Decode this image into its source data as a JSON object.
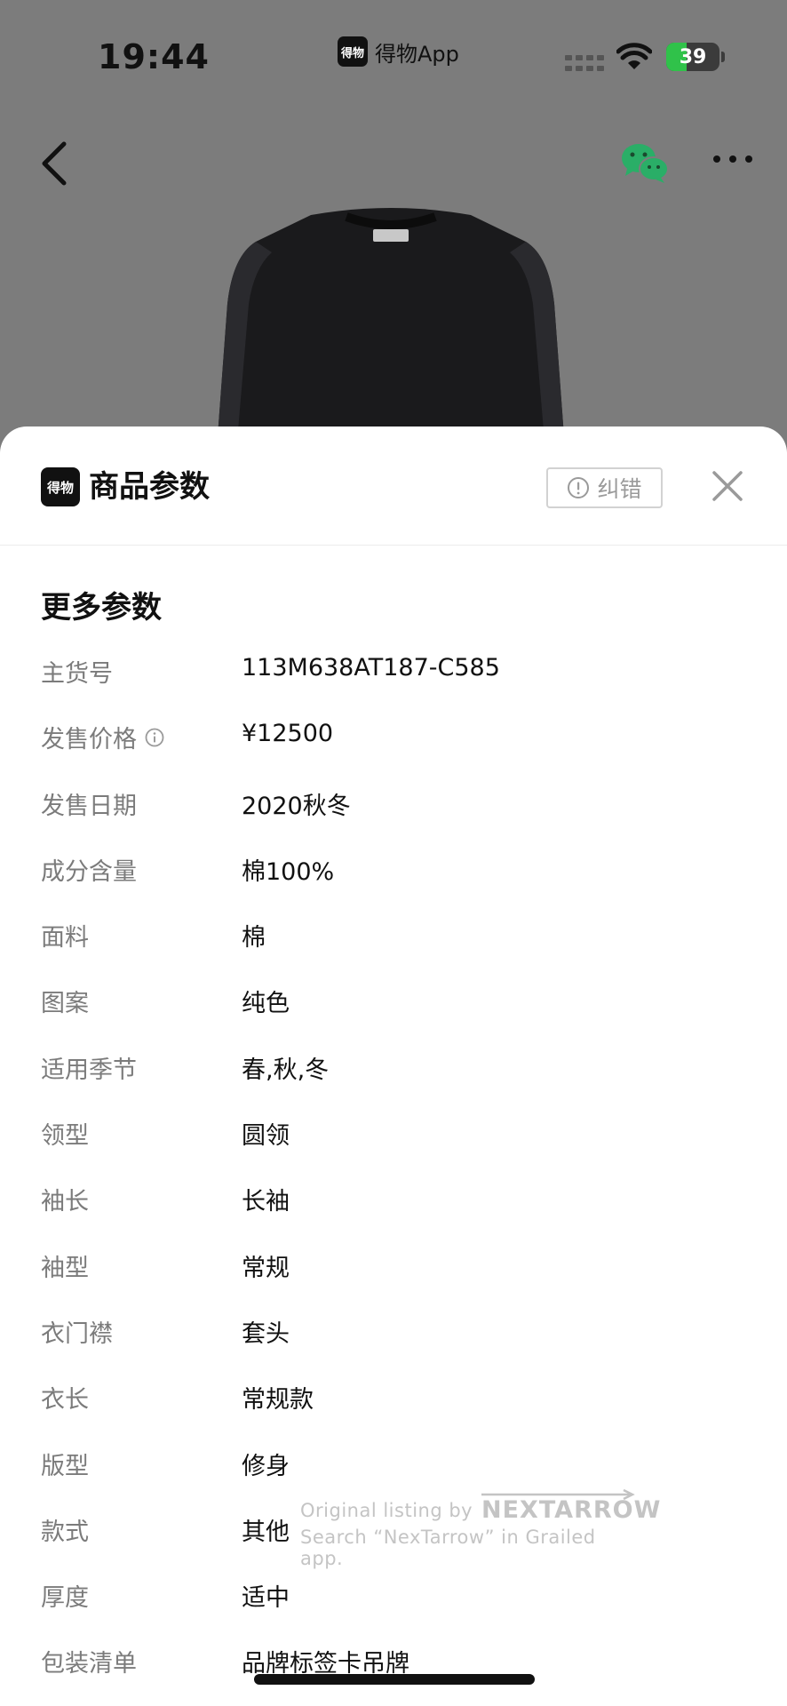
{
  "status_bar": {
    "time": "19:44",
    "app_name": "得物App",
    "app_logo_text": "得物",
    "battery_level": "39",
    "battery_fraction": 0.39
  },
  "nav": {
    "back_icon": "chevron-left-icon",
    "share_icon": "wechat-icon",
    "more_icon": "ellipsis-icon"
  },
  "sheet": {
    "logo_text": "得物",
    "title": "商品参数",
    "report_label": "纠错",
    "section_title": "更多参数",
    "params": [
      {
        "label": "主货号",
        "value": "113M638AT187-C585",
        "info": false
      },
      {
        "label": "发售价格",
        "value": "¥12500",
        "info": true
      },
      {
        "label": "发售日期",
        "value": "2020秋冬",
        "info": false
      },
      {
        "label": "成分含量",
        "value": "棉100%",
        "info": false
      },
      {
        "label": "面料",
        "value": "棉",
        "info": false
      },
      {
        "label": "图案",
        "value": "纯色",
        "info": false
      },
      {
        "label": "适用季节",
        "value": "春,秋,冬",
        "info": false
      },
      {
        "label": "领型",
        "value": "圆领",
        "info": false
      },
      {
        "label": "袖长",
        "value": "长袖",
        "info": false
      },
      {
        "label": "袖型",
        "value": "常规",
        "info": false
      },
      {
        "label": "衣门襟",
        "value": "套头",
        "info": false
      },
      {
        "label": "衣长",
        "value": "常规款",
        "info": false
      },
      {
        "label": "版型",
        "value": "修身",
        "info": false
      },
      {
        "label": "款式",
        "value": "其他",
        "info": false
      },
      {
        "label": "厚度",
        "value": "适中",
        "info": false
      },
      {
        "label": "包装清单",
        "value": "品牌标签卡吊牌",
        "info": false
      }
    ]
  },
  "watermark": {
    "line1": "Original listing by",
    "brand": "NEXTARROW",
    "line2": "Search “NexTarrow” in Grailed app."
  },
  "colors": {
    "overlay": "#7c7c7c",
    "battery_green": "#30c24a",
    "wechat_green": "#2aae67",
    "label_gray": "#7b7b7b"
  }
}
